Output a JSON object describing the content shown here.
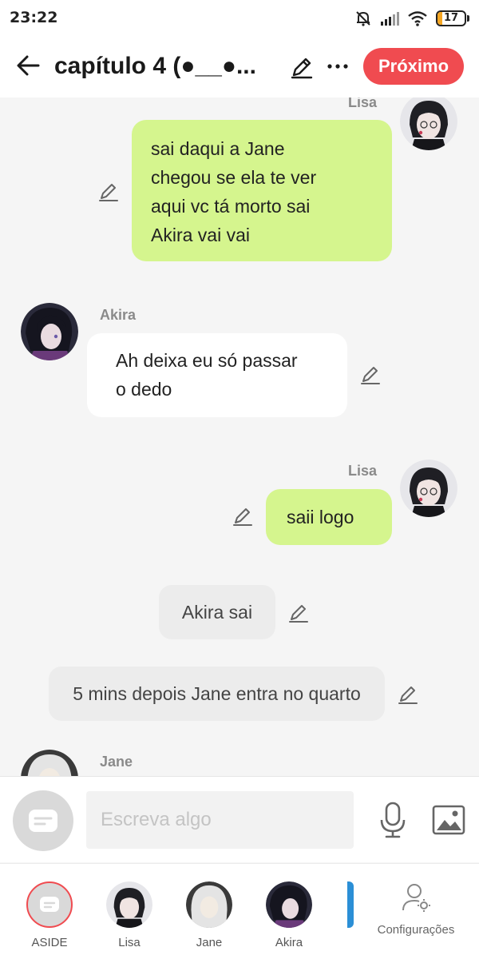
{
  "status_bar": {
    "time": "23:22",
    "battery": "17",
    "battery_level_percent": 17,
    "icons": [
      "mute-bell-icon",
      "signal-icon",
      "wifi-icon",
      "battery-icon"
    ]
  },
  "header": {
    "title": "capítulo 4  (●__●...",
    "next_label": "Próximo",
    "accent_color": "#f04b50"
  },
  "messages": [
    {
      "type": "sent",
      "sender": "Lisa",
      "text_lines": [
        "sai daqui a Jane",
        "chegou se ela te ver",
        "aqui vc tá morto sai",
        "Akira vai vai"
      ]
    },
    {
      "type": "received",
      "sender": "Akira",
      "text_lines": [
        "Ah deixa eu só passar",
        "o dedo"
      ]
    },
    {
      "type": "sent",
      "sender": "Lisa",
      "text_lines": [
        "saii logo"
      ]
    },
    {
      "type": "narration",
      "text": "Akira sai"
    },
    {
      "type": "narration",
      "text": "5 mins depois Jane entra no quarto"
    },
    {
      "type": "received",
      "sender": "Jane",
      "text_lines": []
    }
  ],
  "input": {
    "placeholder": "Escreva algo"
  },
  "bottom_bar": {
    "items": [
      {
        "label": "ASIDE"
      },
      {
        "label": "Lisa"
      },
      {
        "label": "Jane"
      },
      {
        "label": "Akira"
      }
    ],
    "settings_label": "Configurações"
  },
  "colors": {
    "sent_bubble": "#d5f58e",
    "received_bubble": "#ffffff",
    "narration_bubble": "#ececec",
    "background": "#f5f5f5"
  }
}
